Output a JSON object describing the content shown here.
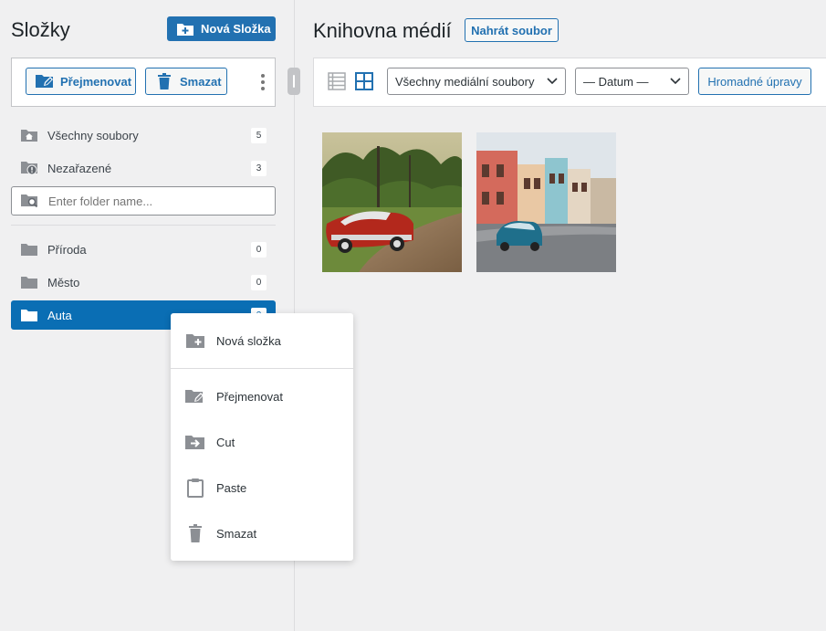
{
  "sidebar": {
    "title": "Složky",
    "new_folder_button": "Nová Složka",
    "rename_button": "Přejmenovat",
    "delete_button": "Smazat",
    "items_top": [
      {
        "label": "Všechny soubory",
        "count": "5",
        "icon": "home-folder-icon"
      },
      {
        "label": "Nezařazené",
        "count": "3",
        "icon": "info-folder-icon"
      }
    ],
    "search_placeholder": "Enter folder name...",
    "folders": [
      {
        "label": "Příroda",
        "count": "0"
      },
      {
        "label": "Město",
        "count": "0"
      },
      {
        "label": "Auta",
        "count": "2",
        "active": true
      }
    ]
  },
  "library": {
    "title": "Knihovna médií",
    "upload_button": "Nahrát soubor",
    "filter_type": "Všechny mediální soubory",
    "filter_date": "— Datum —",
    "bulk_button": "Hromadné úpravy",
    "view_modes": [
      "list-view-icon",
      "grid-view-icon"
    ],
    "thumbnails": [
      {
        "name": "red-classic-car",
        "colors": [
          "#6b8a3a",
          "#c0392b"
        ]
      },
      {
        "name": "blue-classic-car-street",
        "colors": [
          "#8fb7d1",
          "#1f6f8b"
        ]
      }
    ]
  },
  "context_menu": {
    "items": [
      {
        "label": "Nová složka",
        "icon": "folder-plus-icon"
      },
      {
        "label": "Přejmenovat",
        "icon": "folder-edit-icon"
      },
      {
        "label": "Cut",
        "icon": "folder-move-icon"
      },
      {
        "label": "Paste",
        "icon": "clipboard-icon"
      },
      {
        "label": "Smazat",
        "icon": "trash-icon"
      }
    ]
  },
  "colors": {
    "primary": "#2271b1",
    "active": "#0a6eb4",
    "background": "#f0f0f1"
  }
}
